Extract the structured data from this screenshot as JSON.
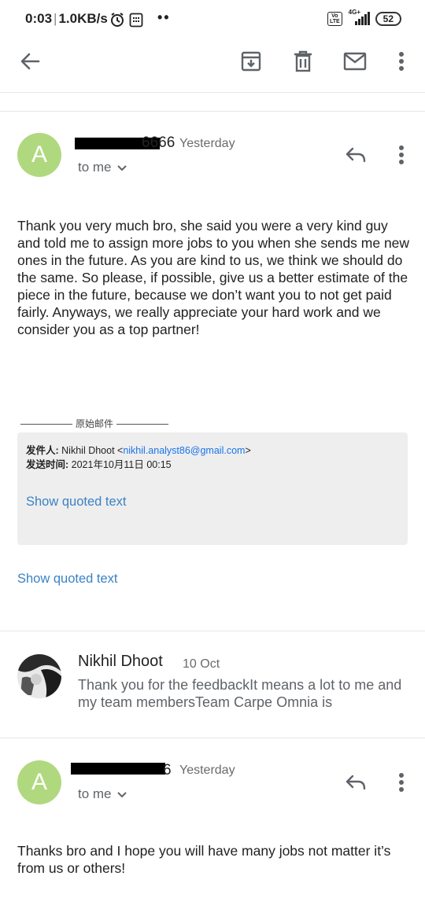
{
  "status_bar": {
    "time": "0:03",
    "net_speed": "1.0KB/s",
    "volte": [
      "Vo",
      "LTE"
    ],
    "network": "4G+",
    "battery": "52",
    "icons": [
      "alarm-icon",
      "calendar-icon",
      "more-notifications-icon",
      "signal-icon",
      "battery-icon"
    ]
  },
  "toolbar": {
    "back_icon": "arrow-left-icon",
    "actions": [
      "archive-icon",
      "delete-icon",
      "mark-unread-icon",
      "more-vert-icon"
    ]
  },
  "messages": [
    {
      "avatar_letter": "A",
      "avatar_color": "#b0d97f",
      "sender_visible": "6666",
      "date": "Yesterday",
      "recipient": "to me",
      "body": "Thank you very much bro, she said you were a very kind guy and told me to assign more jobs to you when she sends me new ones in the future. As you are kind to us, we think we should do the same. So please, if possible, give us a better estimate of the piece in the future, because we don’t want you to not get paid fairly. Anyways, we really appreciate your hard work and we consider you as a top partner!",
      "original_header": "原始邮件",
      "quote": {
        "from_label": "发件人:",
        "from_name": "Nikhil Dhoot <",
        "from_email": "nikhil.analyst86@gmail.com",
        "from_close": ">",
        "sent_label": "发送时间:",
        "sent_value": "2021年10月11日 00:15",
        "show_quoted": "Show quoted text"
      },
      "show_quoted": "Show quoted text"
    },
    {
      "collapsed": true,
      "sender": "Nikhil Dhoot",
      "date": "10 Oct",
      "snippet": "Thank you for the feedbackIt means a lot to me and my team membersTeam Carpe Omnia is"
    },
    {
      "avatar_letter": "A",
      "avatar_color": "#b0d97f",
      "sender_visible": "6",
      "date": "Yesterday",
      "recipient": "to me",
      "body": "Thanks bro and I hope you will have many jobs not matter it’s from us or others!"
    }
  ],
  "colors": {
    "link": "#3b82c4",
    "avatar": "#b0d97f",
    "quote_bg": "#eeeeee"
  }
}
